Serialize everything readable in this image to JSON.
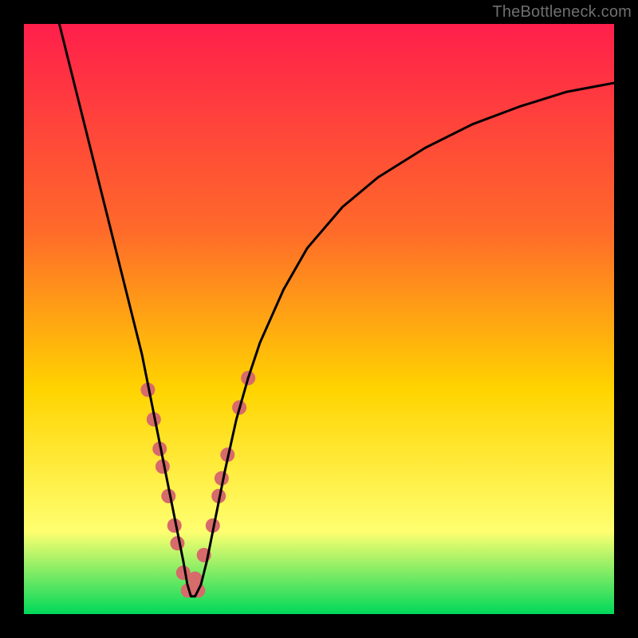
{
  "attribution": "TheBottleneck.com",
  "chart_data": {
    "type": "line",
    "title": "",
    "xlabel": "",
    "ylabel": "",
    "xlim": [
      0,
      100
    ],
    "ylim": [
      0,
      100
    ],
    "gradient_colors": {
      "top": "#ff1f4b",
      "upper_mid": "#ff6a2a",
      "mid": "#ffd400",
      "lower_mid": "#ffff70",
      "bottom": "#00d85a"
    },
    "curve": {
      "x": [
        6,
        8,
        10,
        12,
        14,
        16,
        18,
        20,
        22,
        23,
        24,
        25,
        26,
        27,
        27.7,
        28.3,
        29,
        30,
        31,
        32,
        33,
        34,
        36,
        38,
        40,
        44,
        48,
        54,
        60,
        68,
        76,
        84,
        92,
        100
      ],
      "y": [
        100,
        92,
        84,
        76,
        68,
        60,
        52,
        44,
        34,
        29,
        24,
        19,
        14,
        9,
        5,
        3,
        3,
        5,
        9,
        14,
        19,
        24,
        33,
        40,
        46,
        55,
        62,
        69,
        74,
        79,
        83,
        86,
        88.5,
        90
      ]
    },
    "dots": {
      "x": [
        21.0,
        22.0,
        23.0,
        23.5,
        24.5,
        25.5,
        26.0,
        27.0,
        27.8,
        29.5,
        29.0,
        30.5,
        32.0,
        33.0,
        33.5,
        34.5,
        36.5,
        38.0
      ],
      "y": [
        38.0,
        33.0,
        28.0,
        25.0,
        20.0,
        15.0,
        12.0,
        7.0,
        4.0,
        4.0,
        6.0,
        10.0,
        15.0,
        20.0,
        23.0,
        27.0,
        35.0,
        40.0
      ],
      "color": "#d76a6a",
      "radius": 9
    }
  }
}
